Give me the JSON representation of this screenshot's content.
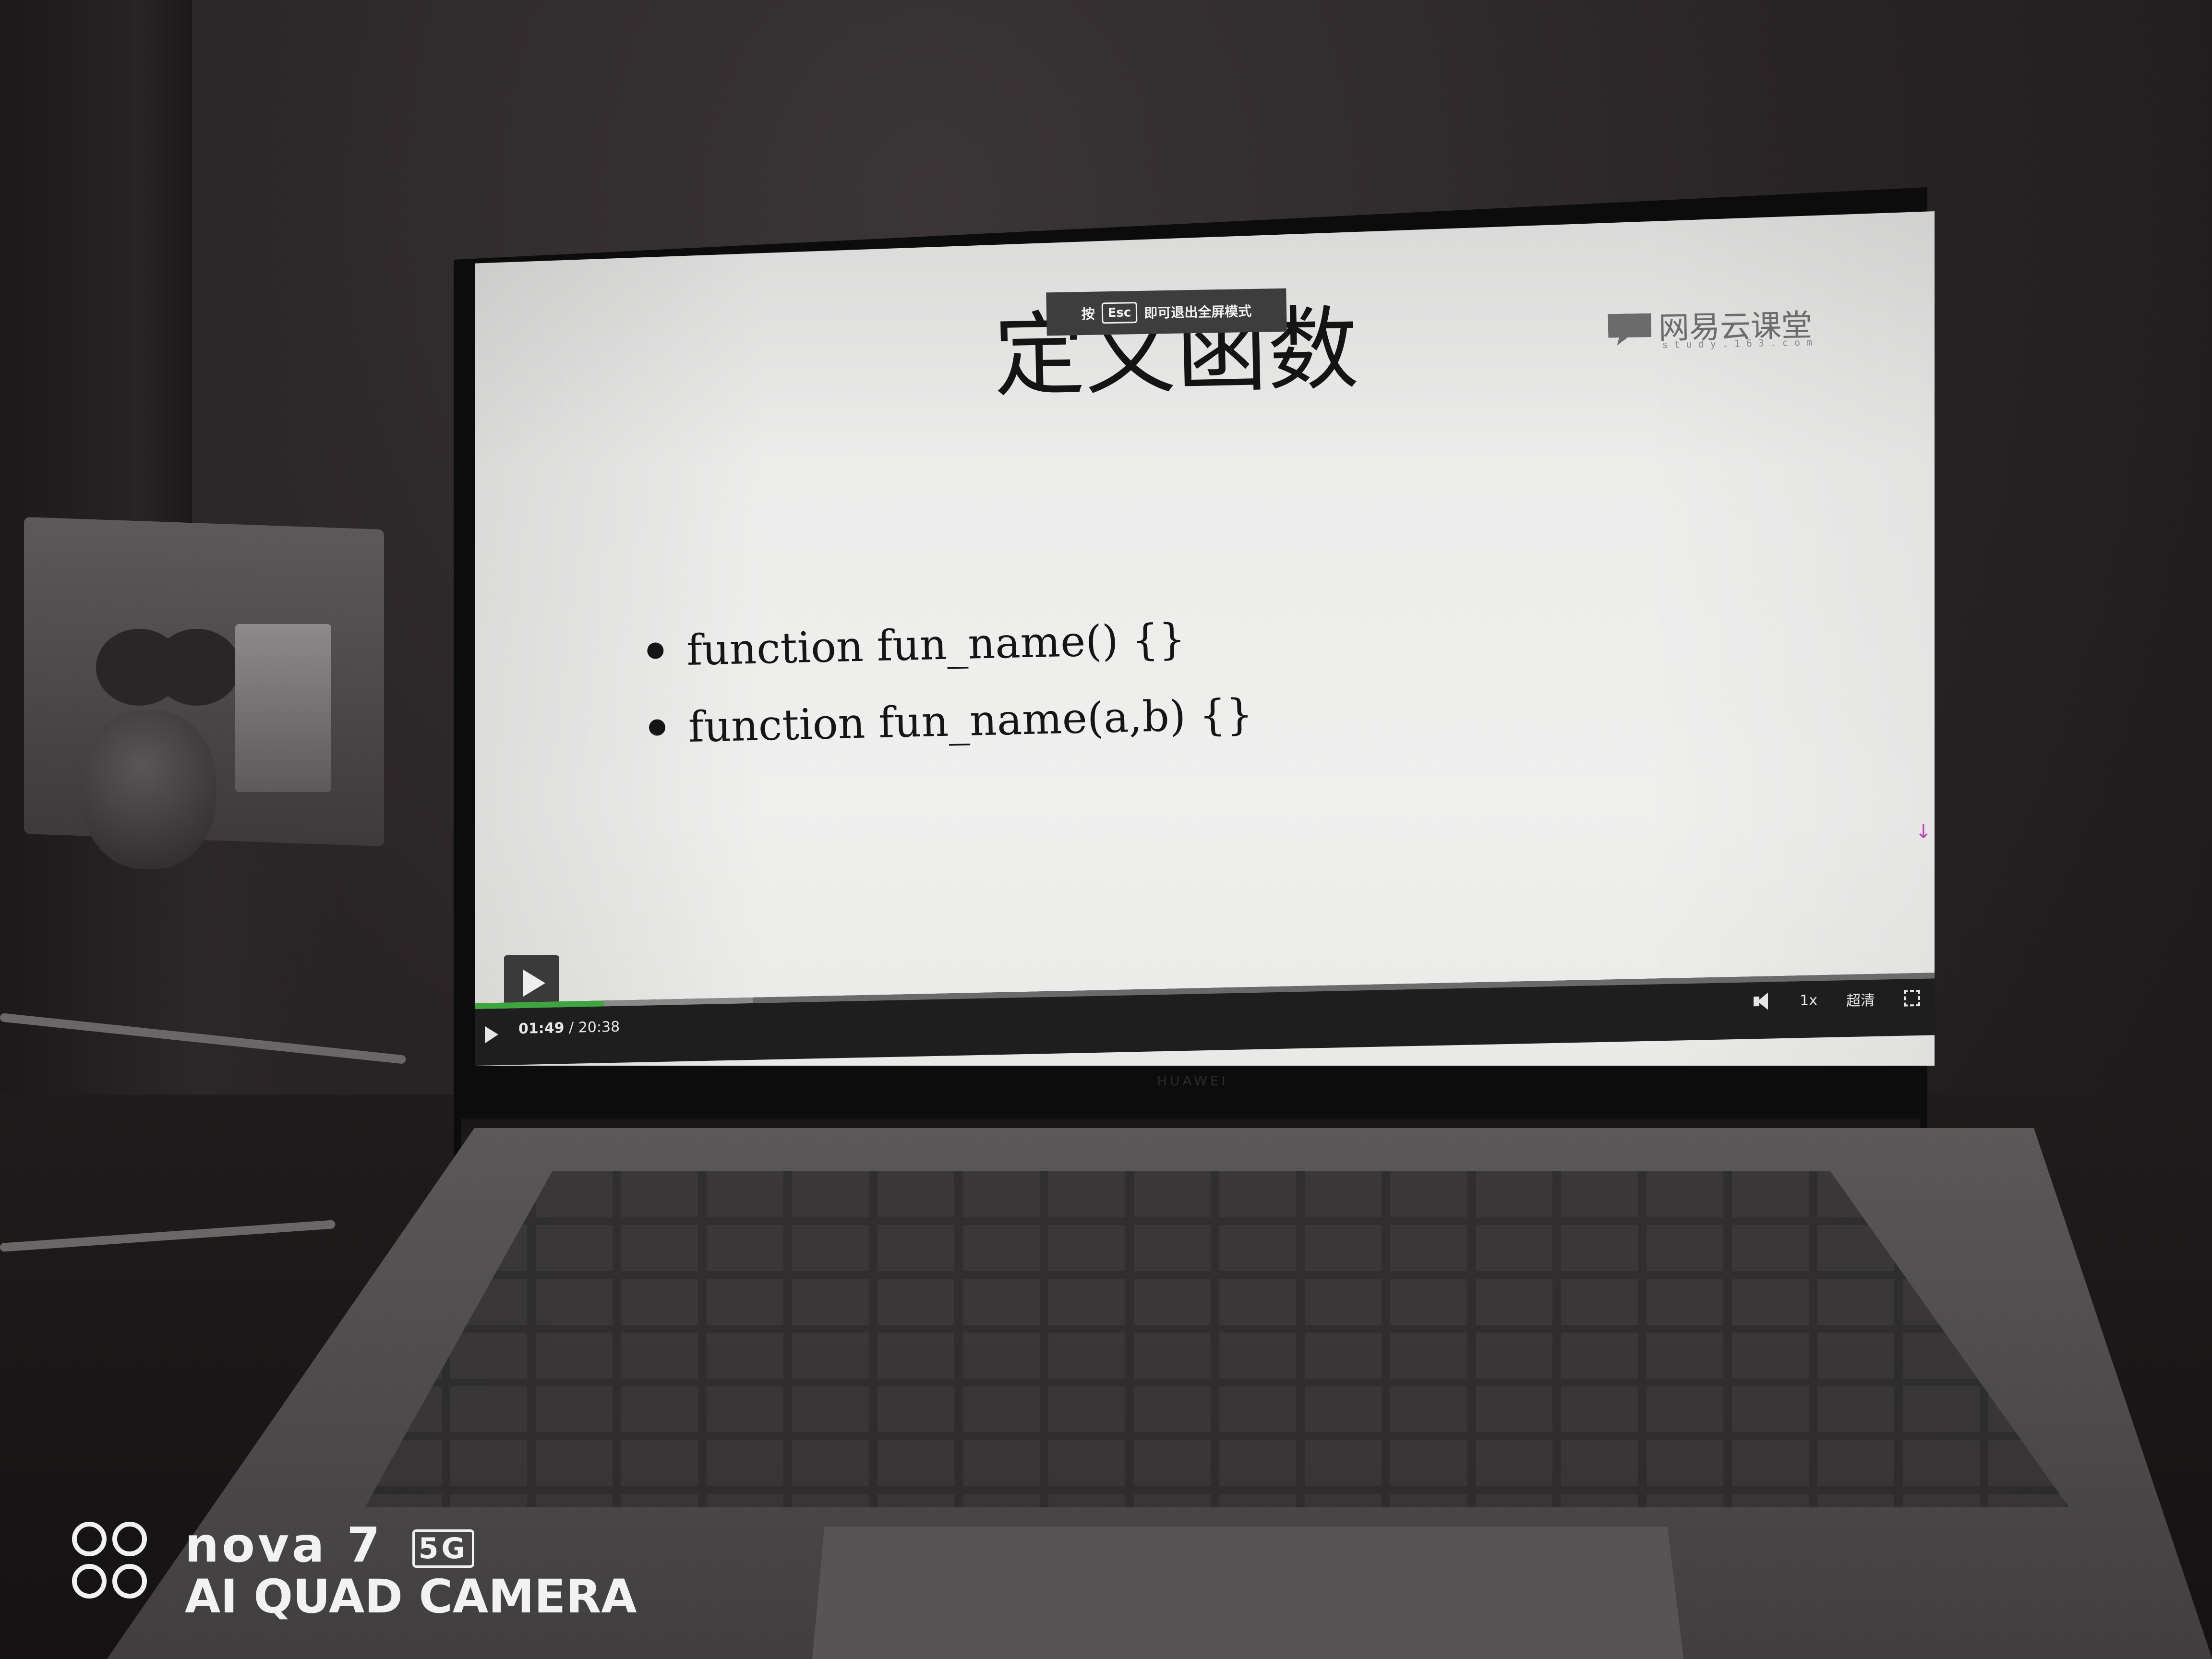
{
  "slide": {
    "title": "定义函数",
    "bullets": [
      "function fun_name() {}",
      "function fun_name(a,b) {}"
    ]
  },
  "logo": {
    "name": "网易云课堂",
    "url_text": "study.163.com"
  },
  "esc_toast": {
    "prefix": "按",
    "key": "Esc",
    "suffix": "即可退出全屏模式"
  },
  "player": {
    "current_time": "01:49",
    "separator": "/",
    "total_time": "20:38",
    "speed": "1x",
    "quality": "超清",
    "progress_fraction": 0.088,
    "buffered_fraction": 0.19,
    "progress_color": "#3fa63f"
  },
  "laptop": {
    "brand": "HUAWEI"
  },
  "watermark": {
    "brand": "nova 7",
    "badge": "5G",
    "subtitle": "AI QUAD CAMERA"
  }
}
